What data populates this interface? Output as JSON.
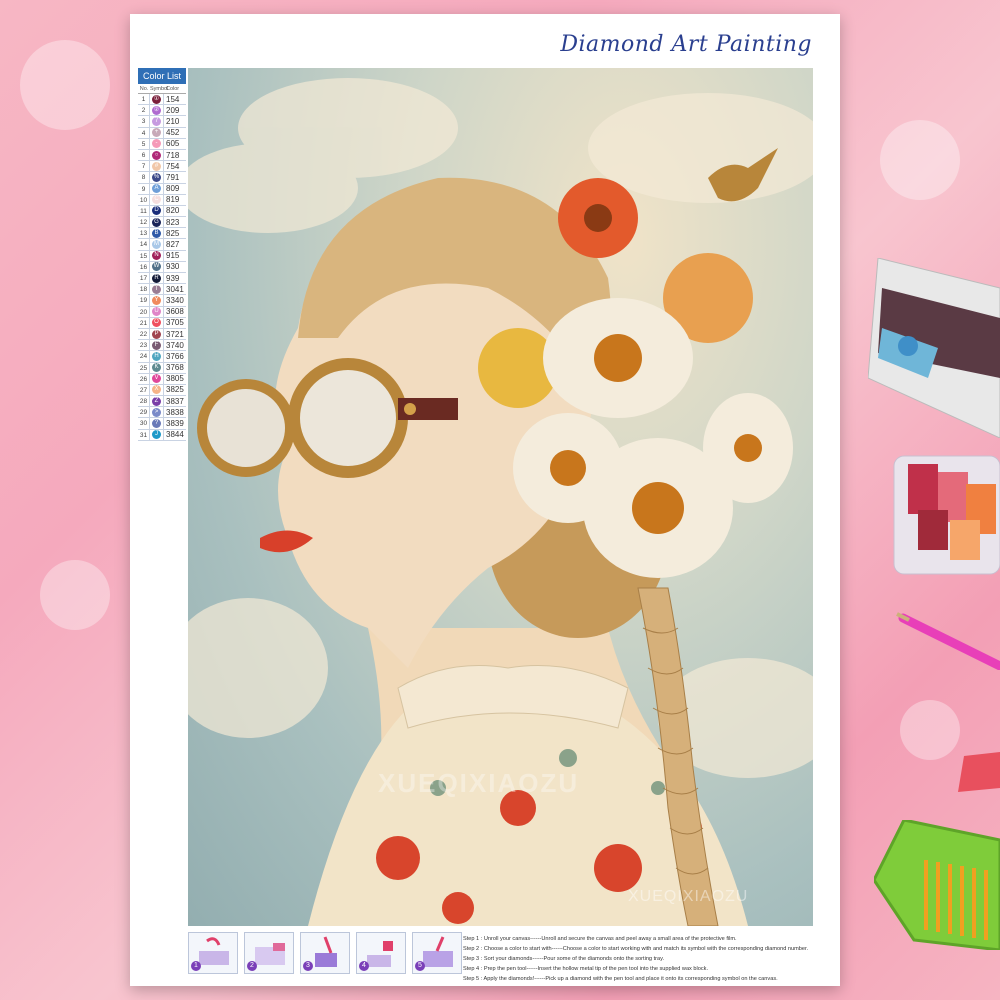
{
  "brand": {
    "title": "Diamond Art Painting"
  },
  "color_list": {
    "title": "Color List",
    "headers": [
      "No.",
      "Symbol",
      "Color"
    ],
    "rows": [
      {
        "no": "1",
        "sym": "①",
        "code": "154",
        "color": "#7a1f3a"
      },
      {
        "no": "2",
        "sym": "②",
        "code": "209",
        "color": "#b06ad0"
      },
      {
        "no": "3",
        "sym": "7",
        "code": "210",
        "color": "#c79be0"
      },
      {
        "no": "4",
        "sym": "+",
        "code": "452",
        "color": "#c8a9b8"
      },
      {
        "no": "5",
        "sym": "-",
        "code": "605",
        "color": "#f59ab8"
      },
      {
        "no": "6",
        "sym": "○",
        "code": "718",
        "color": "#b02a78"
      },
      {
        "no": "7",
        "sym": "#",
        "code": "754",
        "color": "#f1c7a8"
      },
      {
        "no": "8",
        "sym": "%",
        "code": "791",
        "color": "#3d4a8a"
      },
      {
        "no": "9",
        "sym": "A",
        "code": "809",
        "color": "#6f9fd8"
      },
      {
        "no": "10",
        "sym": "C",
        "code": "819",
        "color": "#f6dede"
      },
      {
        "no": "11",
        "sym": "D",
        "code": "820",
        "color": "#1b2e7a"
      },
      {
        "no": "12",
        "sym": "G",
        "code": "823",
        "color": "#1a2458"
      },
      {
        "no": "13",
        "sym": "B",
        "code": "825",
        "color": "#2f5aa8"
      },
      {
        "no": "14",
        "sym": "M",
        "code": "827",
        "color": "#a9c8e8"
      },
      {
        "no": "15",
        "sym": "N",
        "code": "915",
        "color": "#a0205a"
      },
      {
        "no": "16",
        "sym": "W",
        "code": "930",
        "color": "#4f6f88"
      },
      {
        "no": "17",
        "sym": "R",
        "code": "939",
        "color": "#141a38"
      },
      {
        "no": "18",
        "sym": "T",
        "code": "3041",
        "color": "#9a7c94"
      },
      {
        "no": "19",
        "sym": "Y",
        "code": "3340",
        "color": "#f08a5e"
      },
      {
        "no": "20",
        "sym": "U",
        "code": "3608",
        "color": "#e085c8"
      },
      {
        "no": "21",
        "sym": "O",
        "code": "3705",
        "color": "#f04f5e"
      },
      {
        "no": "22",
        "sym": "P",
        "code": "3721",
        "color": "#a04450"
      },
      {
        "no": "23",
        "sym": "F",
        "code": "3740",
        "color": "#7a5a72"
      },
      {
        "no": "24",
        "sym": "H",
        "code": "3766",
        "color": "#4fa6c0"
      },
      {
        "no": "25",
        "sym": "K",
        "code": "3768",
        "color": "#5f8a90"
      },
      {
        "no": "26",
        "sym": "V",
        "code": "3805",
        "color": "#e0489a"
      },
      {
        "no": "27",
        "sym": "X",
        "code": "3825",
        "color": "#f6b488"
      },
      {
        "no": "28",
        "sym": "Z",
        "code": "3837",
        "color": "#7a3fa8"
      },
      {
        "no": "29",
        "sym": ">",
        "code": "3838",
        "color": "#7a8ac8"
      },
      {
        "no": "30",
        "sym": "?",
        "code": "3839",
        "color": "#6a7ab8"
      },
      {
        "no": "31",
        "sym": "J",
        "code": "3844",
        "color": "#1f9ac8"
      }
    ]
  },
  "watermark": {
    "primary": "XUEQIXIAOZU",
    "secondary": "XUEQIXIAOZU"
  },
  "steps": {
    "icons": [
      "1",
      "2",
      "3",
      "4",
      "5"
    ],
    "lines": [
      "Step 1 : Unroll your canvas------Unroll and secure the canvas and peel away a small area of the protective film.",
      "Step 2 : Choose a color to start with------Choose a color to start working with and match its symbol with the corresponding diamond number.",
      "Step 3 : Sort your diamonds------Pour some of the diamonds onto the sorting tray.",
      "Step 4 : Prep the pen tool------Insert the hollow metal tip of the pen tool into the supplied wax block.",
      "Step 5 : Apply the diamonds!------Pick up a diamond with the pen tool and place it onto its corresponding symbol on the canvas."
    ]
  },
  "colors": {
    "background": "#f6b4c2",
    "brand": "#2a3f8f",
    "list_header": "#2f6fb6"
  }
}
